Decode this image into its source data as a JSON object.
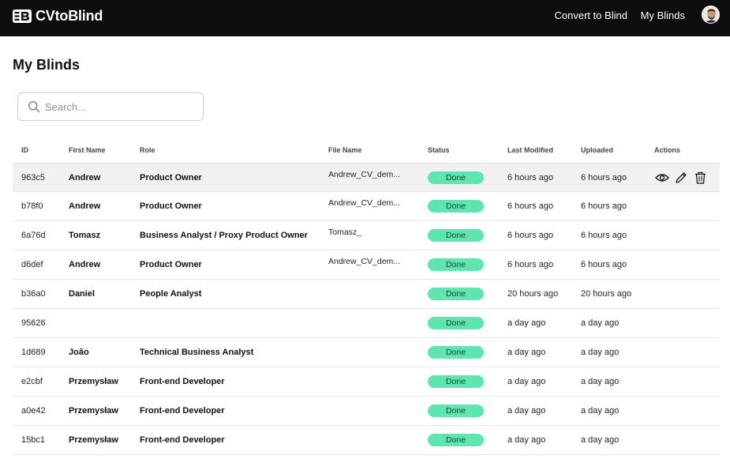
{
  "app": {
    "name": "CVtoBlind"
  },
  "nav": {
    "convert": "Convert to Blind",
    "my_blinds": "My Blinds"
  },
  "page": {
    "title": "My Blinds"
  },
  "search": {
    "placeholder": "Search..."
  },
  "table": {
    "headers": {
      "id": "ID",
      "first_name": "First Name",
      "role": "Role",
      "file_name": "File Name",
      "status": "Status",
      "last_modified": "Last Modified",
      "uploaded": "Uploaded",
      "actions": "Actions"
    },
    "rows": [
      {
        "id": "963c5",
        "first_name": "Andrew",
        "role": "Product Owner",
        "file_name": "Andrew_CV_dem...",
        "status": "Done",
        "last_modified": "6 hours ago",
        "uploaded": "6 hours ago"
      },
      {
        "id": "b78f0",
        "first_name": "Andrew",
        "role": "Product Owner",
        "file_name": "Andrew_CV_dem...",
        "status": "Done",
        "last_modified": "6 hours ago",
        "uploaded": "6 hours ago"
      },
      {
        "id": "6a76d",
        "first_name": "Tomasz",
        "role": "Business Analyst / Proxy Product Owner",
        "file_name": "Tomasz_",
        "status": "Done",
        "last_modified": "6 hours ago",
        "uploaded": "6 hours ago"
      },
      {
        "id": "d6def",
        "first_name": "Andrew",
        "role": "Product Owner",
        "file_name": "Andrew_CV_dem...",
        "status": "Done",
        "last_modified": "6 hours ago",
        "uploaded": "6 hours ago"
      },
      {
        "id": "b36a0",
        "first_name": "Daniel",
        "role": "People Analyst",
        "file_name": "",
        "status": "Done",
        "last_modified": "20 hours ago",
        "uploaded": "20 hours ago"
      },
      {
        "id": "95626",
        "first_name": "",
        "role": "",
        "file_name": "",
        "status": "Done",
        "last_modified": "a day ago",
        "uploaded": "a day ago"
      },
      {
        "id": "1d689",
        "first_name": "João",
        "role": "Technical Business Analyst",
        "file_name": "",
        "status": "Done",
        "last_modified": "a day ago",
        "uploaded": "a day ago"
      },
      {
        "id": "e2cbf",
        "first_name": "Przemysław",
        "role": "Front-end Developer",
        "file_name": "",
        "status": "Done",
        "last_modified": "a day ago",
        "uploaded": "a day ago"
      },
      {
        "id": "a0e42",
        "first_name": "Przemysław",
        "role": "Front-end Developer",
        "file_name": "",
        "status": "Done",
        "last_modified": "a day ago",
        "uploaded": "a day ago"
      },
      {
        "id": "15bc1",
        "first_name": "Przemysław",
        "role": "Front-end Developer",
        "file_name": "",
        "status": "Done",
        "last_modified": "a day ago",
        "uploaded": "a day ago"
      }
    ],
    "row_actions": [
      "eye-icon",
      "pencil-icon",
      "trash-icon"
    ]
  },
  "colors": {
    "topbar": "#0d0d0d",
    "status_done": "#5fe5b0",
    "row_highlight": "#f1f1f1"
  }
}
